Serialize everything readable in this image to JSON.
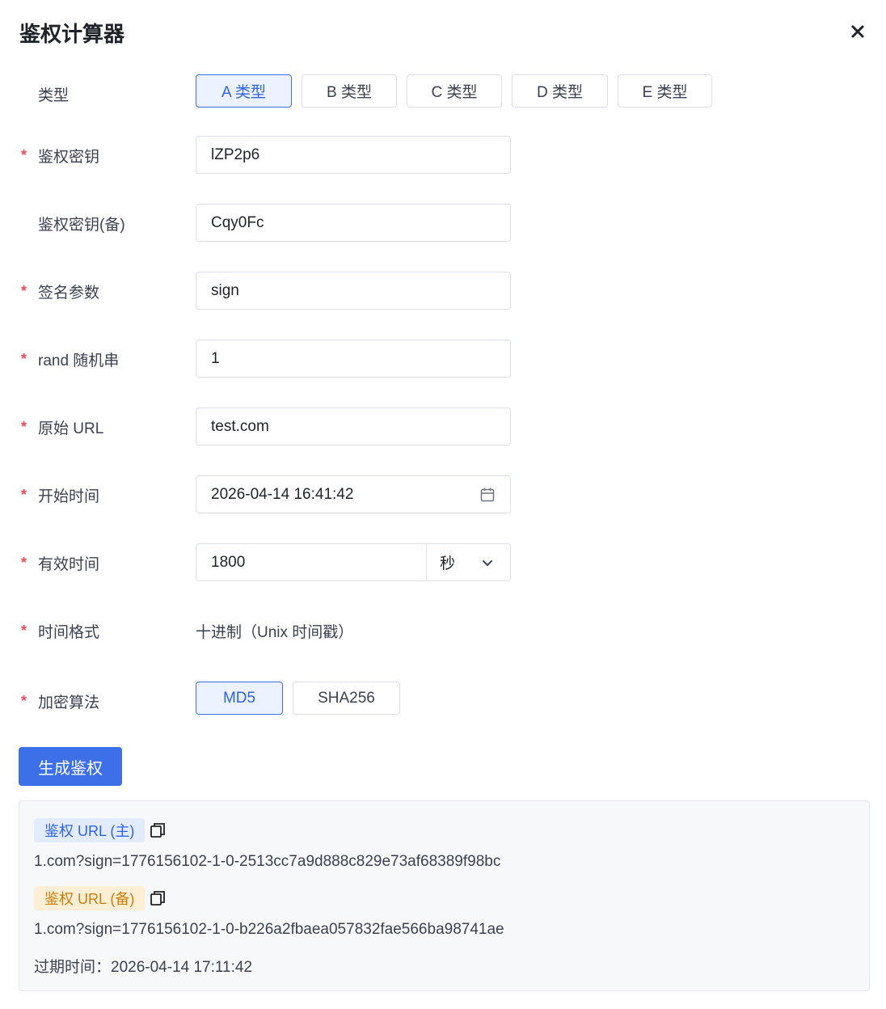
{
  "dialog": {
    "title": "鉴权计算器"
  },
  "type_field": {
    "label": "类型",
    "options": [
      "A 类型",
      "B 类型",
      "C 类型",
      "D 类型",
      "E 类型"
    ],
    "selected": "A 类型"
  },
  "auth_key": {
    "required": true,
    "label": "鉴权密钥",
    "value": "lZP2p6"
  },
  "auth_key_backup": {
    "required": false,
    "label": "鉴权密钥(备)",
    "value": "Cqy0Fc"
  },
  "sign_param": {
    "required": true,
    "label": "签名参数",
    "value": "sign"
  },
  "rand_string": {
    "required": true,
    "label": "rand 随机串",
    "value": "1"
  },
  "origin_url": {
    "required": true,
    "label": "原始 URL",
    "value": "test.com"
  },
  "start_time": {
    "required": true,
    "label": "开始时间",
    "value": "2026-04-14 16:41:42",
    "icon": "calendar-icon"
  },
  "valid_time": {
    "required": true,
    "label": "有效时间",
    "value": "1800",
    "unit": "秒"
  },
  "time_format": {
    "required": true,
    "label": "时间格式",
    "value": "十进制（Unix 时间戳）"
  },
  "algorithm": {
    "required": true,
    "label": "加密算法",
    "options": [
      "MD5",
      "SHA256"
    ],
    "selected": "MD5"
  },
  "generate_button": {
    "label": "生成鉴权"
  },
  "result": {
    "primary_tag": "鉴权 URL (主)",
    "primary_url": "1.com?sign=1776156102-1-0-2513cc7a9d888c829e73af68389f98bc",
    "backup_tag": "鉴权 URL (备)",
    "backup_url": "1.com?sign=1776156102-1-0-b226a2fbaea057832fae566ba98741ae",
    "expire_label": "过期时间：",
    "expire_value": "2026-04-14 17:11:42"
  },
  "colors": {
    "accent": "#3d6fe8",
    "required_mark": "#e34d59",
    "backup_tag_text": "#c87f0a"
  }
}
